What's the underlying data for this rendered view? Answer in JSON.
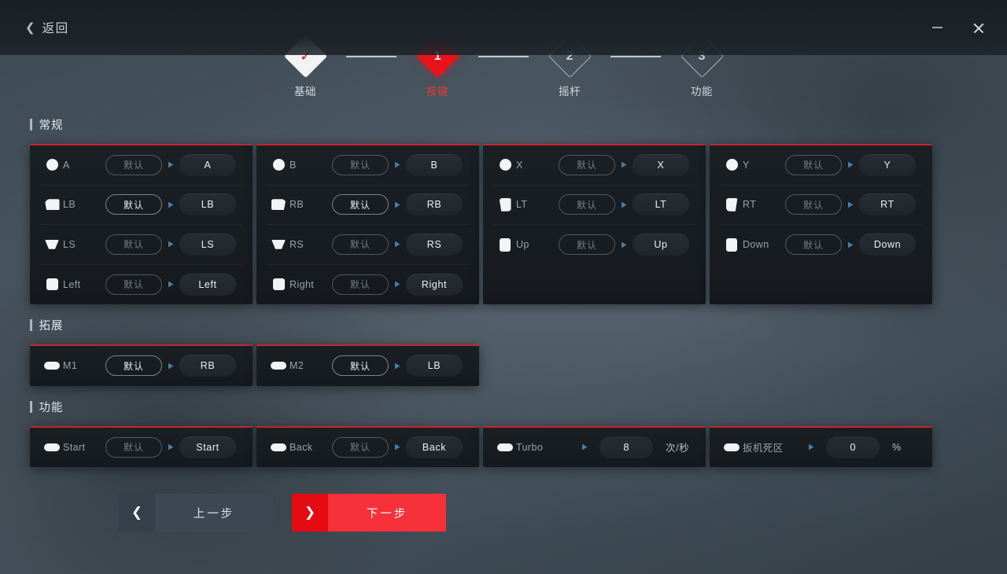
{
  "titlebar": {
    "back_label": "返回",
    "back_icon": "chevron-left-icon",
    "minimize_icon": "minimize-icon",
    "close_icon": "close-icon"
  },
  "stepper": {
    "steps": [
      {
        "glyph": "✓",
        "label": "基础",
        "state": "done"
      },
      {
        "glyph": "1",
        "label": "按键",
        "state": "active"
      },
      {
        "glyph": "2",
        "label": "摇杆",
        "state": "idle"
      },
      {
        "glyph": "3",
        "label": "功能",
        "state": "idle"
      }
    ]
  },
  "colors": {
    "accent_red": "#e8131a",
    "card_border_red": "#c8232c",
    "next_button": "#f83038",
    "prev_button": "#3c4751"
  },
  "sections": [
    {
      "title": "常规",
      "cards": [
        {
          "rows": [
            {
              "icon": "button-circle-icon",
              "label": "A",
              "default_label": "默认",
              "default_strong": false,
              "value": "A"
            },
            {
              "icon": "bumper-left-icon",
              "label": "LB",
              "default_label": "默认",
              "default_strong": true,
              "value": "LB"
            },
            {
              "icon": "stick-icon",
              "label": "LS",
              "default_label": "默认",
              "default_strong": false,
              "value": "LS"
            },
            {
              "icon": "dpad-icon",
              "label": "Left",
              "default_label": "默认",
              "default_strong": false,
              "value": "Left"
            }
          ]
        },
        {
          "rows": [
            {
              "icon": "button-circle-icon",
              "label": "B",
              "default_label": "默认",
              "default_strong": false,
              "value": "B"
            },
            {
              "icon": "bumper-right-icon",
              "label": "RB",
              "default_label": "默认",
              "default_strong": true,
              "value": "RB"
            },
            {
              "icon": "stick-icon",
              "label": "RS",
              "default_label": "默认",
              "default_strong": false,
              "value": "RS"
            },
            {
              "icon": "dpad-icon",
              "label": "Right",
              "default_label": "默认",
              "default_strong": false,
              "value": "Right"
            }
          ]
        },
        {
          "rows": [
            {
              "icon": "button-circle-icon",
              "label": "X",
              "default_label": "默认",
              "default_strong": false,
              "value": "X"
            },
            {
              "icon": "trigger-left-icon",
              "label": "LT",
              "default_label": "默认",
              "default_strong": false,
              "value": "LT"
            },
            {
              "icon": "dpad-up-icon",
              "label": "Up",
              "default_label": "默认",
              "default_strong": false,
              "value": "Up"
            }
          ]
        },
        {
          "rows": [
            {
              "icon": "button-circle-icon",
              "label": "Y",
              "default_label": "默认",
              "default_strong": false,
              "value": "Y"
            },
            {
              "icon": "trigger-right-icon",
              "label": "RT",
              "default_label": "默认",
              "default_strong": false,
              "value": "RT"
            },
            {
              "icon": "dpad-down-icon",
              "label": "Down",
              "default_label": "默认",
              "default_strong": false,
              "value": "Down"
            }
          ]
        }
      ]
    },
    {
      "title": "拓展",
      "cards": [
        {
          "rows": [
            {
              "icon": "toggle-icon",
              "label": "M1",
              "default_label": "默认",
              "default_strong": true,
              "value": "RB"
            }
          ]
        },
        {
          "rows": [
            {
              "icon": "toggle-icon",
              "label": "M2",
              "default_label": "默认",
              "default_strong": true,
              "value": "LB"
            }
          ]
        }
      ]
    },
    {
      "title": "功能",
      "cards": [
        {
          "rows": [
            {
              "icon": "toggle-icon",
              "label": "Start",
              "default_label": "默认",
              "default_strong": false,
              "value": "Start"
            }
          ]
        },
        {
          "rows": [
            {
              "icon": "toggle-icon",
              "label": "Back",
              "default_label": "默认",
              "default_strong": false,
              "value": "Back"
            }
          ]
        },
        {
          "numeric": {
            "icon": "toggle-icon",
            "label": "Turbo",
            "value": "8",
            "unit": "次/秒"
          }
        },
        {
          "numeric": {
            "icon": "toggle-icon",
            "label": "扳机死区",
            "value": "0",
            "unit": "%"
          }
        }
      ]
    }
  ],
  "footer": {
    "prev_label": "上一步",
    "prev_icon": "chevron-left-icon",
    "next_label": "下一步",
    "next_icon": "chevron-right-icon"
  }
}
